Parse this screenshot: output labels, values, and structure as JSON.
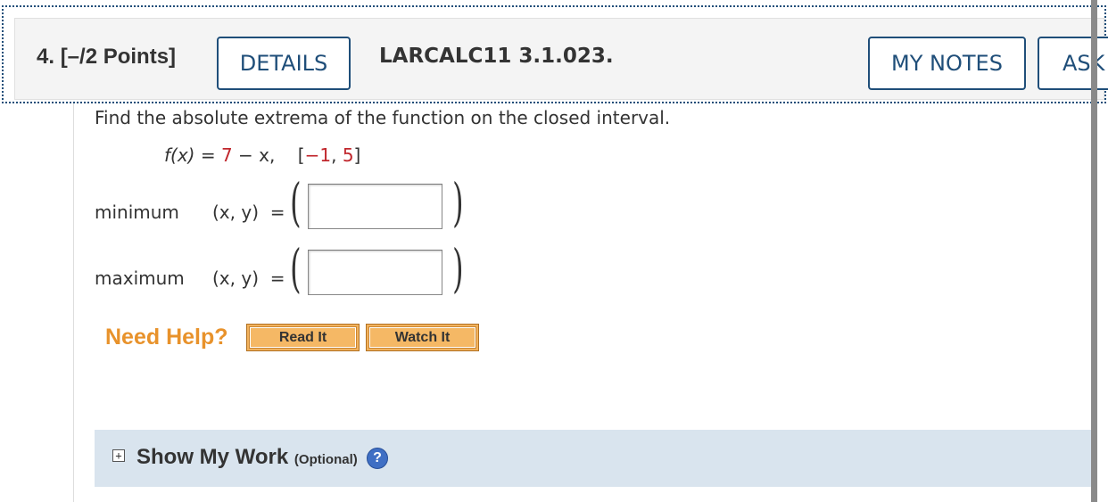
{
  "header": {
    "question_number": "4.",
    "points": "[–/2 Points]",
    "details_label": "DETAILS",
    "problem_code": "LARCALC11 3.1.023.",
    "my_notes_label": "MY NOTES",
    "ask_label": "ASK YOUR TEACHER"
  },
  "question": {
    "prompt": "Find the absolute extrema of the function on the closed interval.",
    "function_lhs": "f(x)",
    "equals": " = ",
    "function_rhs_7": "7",
    "function_rhs_rest": " − x,",
    "interval_open": "    [",
    "interval_a": "−1",
    "interval_sep": ", ",
    "interval_b": "5",
    "interval_close": "]"
  },
  "answers": [
    {
      "label": "minimum",
      "coords": "(x, y)  =",
      "value": ""
    },
    {
      "label": "maximum",
      "coords": "(x, y)  =",
      "value": ""
    }
  ],
  "help": {
    "need_help": "Need Help?",
    "read_it": "Read It",
    "watch_it": "Watch It"
  },
  "work": {
    "expand_icon": "+",
    "title": "Show My Work",
    "optional": "(Optional)",
    "help_icon": "?"
  }
}
